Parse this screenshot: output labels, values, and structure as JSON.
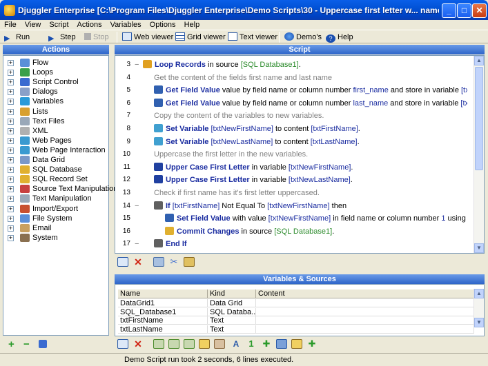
{
  "window": {
    "title": "Djuggler Enterprise  [C:\\Program Files\\Djuggler Enterprise\\Demo Scripts\\30 - Uppercase first letter w... name..."
  },
  "menu": [
    "File",
    "View",
    "Script",
    "Actions",
    "Variables",
    "Options",
    "Help"
  ],
  "toolbar": {
    "run": "Run",
    "step": "Step",
    "stop": "Stop",
    "web_viewer": "Web viewer",
    "grid_viewer": "Grid viewer",
    "text_viewer": "Text viewer",
    "demos": "Demo's",
    "help": "Help"
  },
  "actions_panel": {
    "title": "Actions",
    "items": [
      {
        "label": "Flow",
        "icon": "flow-icon",
        "color": "#5a8fd8"
      },
      {
        "label": "Loops",
        "icon": "loops-icon",
        "color": "#3aa04a"
      },
      {
        "label": "Script Control",
        "icon": "script-control-icon",
        "color": "#3a6bd0"
      },
      {
        "label": "Dialogs",
        "icon": "dialogs-icon",
        "color": "#8aa0c8"
      },
      {
        "label": "Variables",
        "icon": "variables-icon",
        "color": "#2a9ad8"
      },
      {
        "label": "Lists",
        "icon": "lists-icon",
        "color": "#d8a030"
      },
      {
        "label": "Text Files",
        "icon": "text-files-icon",
        "color": "#9aa8b8"
      },
      {
        "label": "XML",
        "icon": "xml-icon",
        "color": "#b0b0b0"
      },
      {
        "label": "Web Pages",
        "icon": "web-pages-icon",
        "color": "#3a9ad0"
      },
      {
        "label": "Web Page Interaction",
        "icon": "web-interaction-icon",
        "color": "#3a9ad0"
      },
      {
        "label": "Data Grid",
        "icon": "data-grid-icon",
        "color": "#7a98c8"
      },
      {
        "label": "SQL Database",
        "icon": "sql-database-icon",
        "color": "#e0b030"
      },
      {
        "label": "SQL Record Set",
        "icon": "sql-recordset-icon",
        "color": "#e0b030"
      },
      {
        "label": "Source Text Manipulation",
        "icon": "source-text-icon",
        "color": "#c84040"
      },
      {
        "label": "Text Manipulation",
        "icon": "text-manipulation-icon",
        "color": "#9aa8b8"
      },
      {
        "label": "Import/Export",
        "icon": "import-export-icon",
        "color": "#c85030"
      },
      {
        "label": "File System",
        "icon": "file-system-icon",
        "color": "#5a8fd8"
      },
      {
        "label": "Email",
        "icon": "email-icon",
        "color": "#c8a060"
      },
      {
        "label": "System",
        "icon": "system-icon",
        "color": "#8a7050"
      }
    ]
  },
  "script_panel": {
    "title": "Script",
    "lines": [
      {
        "num": "3",
        "fold": "−",
        "indent": 0,
        "icon": "loop-icon",
        "icon_color": "#e0a020",
        "parts": [
          [
            "kw",
            "Loop Records"
          ],
          [
            "t",
            " in source "
          ],
          [
            "grn",
            "[SQL Database1]"
          ],
          [
            "t",
            "."
          ]
        ]
      },
      {
        "num": "4",
        "fold": "",
        "indent": 1,
        "icon": "",
        "parts": [
          [
            "cmt",
            "Get the content of the fields first name and last name"
          ]
        ]
      },
      {
        "num": "5",
        "fold": "",
        "indent": 1,
        "icon": "get-field-icon",
        "icon_color": "#3060b0",
        "parts": [
          [
            "kw",
            "Get Field Value"
          ],
          [
            "t",
            " value by field name or column number "
          ],
          [
            "blu",
            "first_name"
          ],
          [
            "t",
            " and store in variable "
          ],
          [
            "blu",
            "[txtFirstName]"
          ],
          [
            "t",
            " ..."
          ]
        ]
      },
      {
        "num": "6",
        "fold": "",
        "indent": 1,
        "icon": "get-field-icon",
        "icon_color": "#3060b0",
        "parts": [
          [
            "kw",
            "Get Field Value"
          ],
          [
            "t",
            " value by field name or column number "
          ],
          [
            "blu",
            "last_name"
          ],
          [
            "t",
            " and store in variable "
          ],
          [
            "blu",
            "[txtLastName]"
          ],
          [
            "t",
            " ..."
          ]
        ]
      },
      {
        "num": "7",
        "fold": "",
        "indent": 1,
        "icon": "",
        "parts": [
          [
            "cmt",
            "Copy the content of the variables to new variables."
          ]
        ]
      },
      {
        "num": "8",
        "fold": "",
        "indent": 1,
        "icon": "set-variable-icon",
        "icon_color": "#40a0d0",
        "parts": [
          [
            "kw",
            "Set Variable"
          ],
          [
            "t",
            " "
          ],
          [
            "blu",
            "[txtNewFirstName]"
          ],
          [
            "t",
            " to content "
          ],
          [
            "blu",
            "[txtFirstName]"
          ],
          [
            "t",
            "."
          ]
        ]
      },
      {
        "num": "9",
        "fold": "",
        "indent": 1,
        "icon": "set-variable-icon",
        "icon_color": "#40a0d0",
        "parts": [
          [
            "kw",
            "Set Variable"
          ],
          [
            "t",
            " "
          ],
          [
            "blu",
            "[txtNewLastName]"
          ],
          [
            "t",
            " to content "
          ],
          [
            "blu",
            "[txtLastName]"
          ],
          [
            "t",
            "."
          ]
        ]
      },
      {
        "num": "10",
        "fold": "",
        "indent": 1,
        "icon": "",
        "parts": [
          [
            "cmt",
            "Uppercase the first letter in the new variables."
          ]
        ]
      },
      {
        "num": "11",
        "fold": "",
        "indent": 1,
        "icon": "uppercase-icon",
        "icon_color": "#2040a0",
        "parts": [
          [
            "kw",
            "Upper Case First Letter"
          ],
          [
            "t",
            " in variable "
          ],
          [
            "blu",
            "[txtNewFirstName]"
          ],
          [
            "t",
            "."
          ]
        ]
      },
      {
        "num": "12",
        "fold": "",
        "indent": 1,
        "icon": "uppercase-icon",
        "icon_color": "#2040a0",
        "parts": [
          [
            "kw",
            "Upper Case First Letter"
          ],
          [
            "t",
            " in variable "
          ],
          [
            "blu",
            "[txtNewLastName]"
          ],
          [
            "t",
            "."
          ]
        ]
      },
      {
        "num": "13",
        "fold": "",
        "indent": 1,
        "icon": "",
        "parts": [
          [
            "cmt",
            "Check if first name has it's first letter uppercased."
          ]
        ]
      },
      {
        "num": "14",
        "fold": "−",
        "indent": 1,
        "icon": "if-icon",
        "icon_color": "#606060",
        "parts": [
          [
            "kw",
            "If"
          ],
          [
            "t",
            " "
          ],
          [
            "blu",
            "[txtFirstName]"
          ],
          [
            "t",
            " Not Equal To "
          ],
          [
            "blu",
            "[txtNewFirstName]"
          ],
          [
            "t",
            " then"
          ]
        ]
      },
      {
        "num": "15",
        "fold": "",
        "indent": 2,
        "icon": "set-field-icon",
        "icon_color": "#3060b0",
        "parts": [
          [
            "kw",
            "Set Field Value"
          ],
          [
            "t",
            " with value "
          ],
          [
            "blu",
            "[txtNewFirstName]"
          ],
          [
            "t",
            " in field name or column number "
          ],
          [
            "blu",
            "1"
          ],
          [
            "t",
            " using "
          ],
          [
            "grn",
            "[SQL Data..."
          ]
        ]
      },
      {
        "num": "16",
        "fold": "",
        "indent": 2,
        "icon": "commit-icon",
        "icon_color": "#e0b030",
        "parts": [
          [
            "kw",
            "Commit Changes"
          ],
          [
            "t",
            " in source "
          ],
          [
            "grn",
            "[SQL Database1]"
          ],
          [
            "t",
            "."
          ]
        ]
      },
      {
        "num": "17",
        "fold": "−",
        "indent": 1,
        "icon": "end-if-icon",
        "icon_color": "#606060",
        "parts": [
          [
            "kw",
            "End If"
          ]
        ]
      }
    ]
  },
  "variables_panel": {
    "title": "Variables & Sources",
    "columns": [
      "Name",
      "Kind",
      "Content"
    ],
    "rows": [
      [
        "DataGrid1",
        "Data Grid",
        ""
      ],
      [
        "SQL_Database1",
        "SQL Databa...",
        ""
      ],
      [
        "txtFirstName",
        "Text",
        ""
      ],
      [
        "txtLastName",
        "Text",
        ""
      ]
    ]
  },
  "status": {
    "text": "Demo Script run took 2 seconds, 6 lines executed."
  },
  "colors": {
    "title_bar": "#0252d6",
    "pane_header": "#2d64c8",
    "keyword": "#1a2ca0",
    "source": "#2a8a2a",
    "comment": "#808080"
  }
}
